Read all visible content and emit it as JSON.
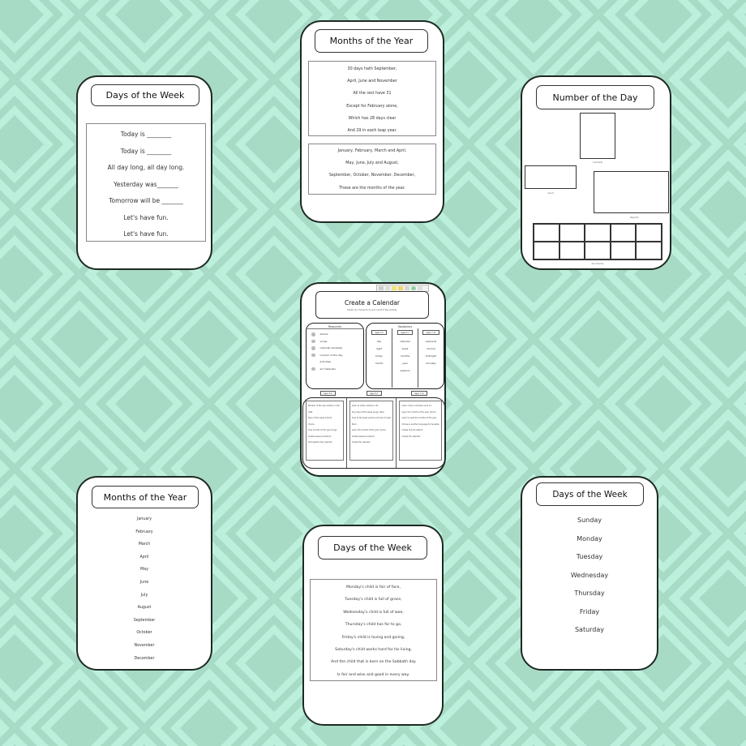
{
  "colors": {
    "background_light": "#bdf0dc",
    "background_dark": "#a8dbc6",
    "card_border": "#1e2a24"
  },
  "cards": {
    "days_rhyme": {
      "title": "Days of the Week",
      "lines": [
        "Today is ________",
        "Today is ________",
        "All day long, all day long.",
        "Yesterday was_______",
        "Tomorrow will be _______",
        "Let's have fun.",
        "Let's have fun."
      ]
    },
    "months_poem": {
      "title": "Months of the Year",
      "verse1": [
        "30 days hath September,",
        "April, June and November",
        "All the rest have 31",
        "Except for February alone,",
        "Which has 28 days clear",
        "And 29 in each leap year."
      ],
      "verse2": [
        "January, February, March and April,",
        "May, June, July and August,",
        "September, October, November, December,",
        "These are the months of the year."
      ]
    },
    "number_of_day": {
      "title": "Number of the Day",
      "labels": {
        "numeral": "numeral",
        "word": "word",
        "objects": "objects",
        "ten_frame": "ten frame"
      }
    },
    "create_calendar": {
      "title": "Create a Calendar",
      "subtitle": "Pupils can choose to do all or part of this activity.",
      "resources": {
        "heading": "Resources",
        "items": [
          {
            "label": "stories",
            "dot": true
          },
          {
            "label": "songs",
            "dot": true
          },
          {
            "label": "calendar template",
            "dot": true
          },
          {
            "label": "number of the day",
            "dot": true
          },
          {
            "label": "activities",
            "dot": false
          },
          {
            "label": "art materials",
            "dot": true
          }
        ]
      },
      "vocabulary": {
        "heading": "Vocabulary",
        "columns": [
          {
            "age": "Ages 3-5",
            "words": [
              "day",
              "night",
              "today",
              "month"
            ]
          },
          {
            "age": "Ages 5-7",
            "words": [
              "calendar",
              "week",
              "months",
              "year",
              "seasons"
            ]
          },
          {
            "age": "Ages 7-11",
            "words": [
              "seasonal",
              "diurnal",
              "fortnight",
              "annually"
            ]
          }
        ]
      },
      "activities": [
        {
          "age": "Ages 3-5",
          "lines": [
            "Number of the day activity on the",
            "date.",
            "Days of the week activity",
            "rhyme.",
            "Sing months of the year songs.",
            "Create seasonal artwork.",
            "Put together the calendar."
          ]
        },
        {
          "age": "Ages 5-7",
          "lines": [
            "Learn to write numbers 1-31.",
            "Sing days of the week songs, label",
            "days of the week poems and learn to spell",
            "them.",
            "Learn the months of the year rhyme.",
            "Create seasonal artwork.",
            "Create the calendar."
          ]
        },
        {
          "age": "Ages 7-11",
          "lines": [
            "Learn roman numerals up to 31.",
            "Learn the months of the year rhyme.",
            "Learn to spell the months of the year.",
            "Choose a another language to translate.",
            "Create diurnal artwork.",
            "Create the calendar."
          ]
        }
      ]
    },
    "months_list": {
      "title": "Months of the Year",
      "items": [
        "January",
        "February",
        "March",
        "April",
        "May",
        "June",
        "July",
        "August",
        "September",
        "October",
        "November",
        "December"
      ]
    },
    "days_poem": {
      "title": "Days of the Week",
      "lines": [
        "Monday's child is fair of face,",
        "Tuesday's child is full of grace,",
        "Wednesday's child is full of woe,",
        "Thursday's child has far to go,",
        "Friday's child is loving and giving,",
        "Saturday's child works hard for his living,",
        "And the child that is born on the Sabbath day",
        "Is fair and wise and good in every way."
      ]
    },
    "days_list": {
      "title": "Days of the Week",
      "items": [
        "Sunday",
        "Monday",
        "Tuesday",
        "Wednesday",
        "Thursday",
        "Friday",
        "Saturday"
      ]
    }
  }
}
